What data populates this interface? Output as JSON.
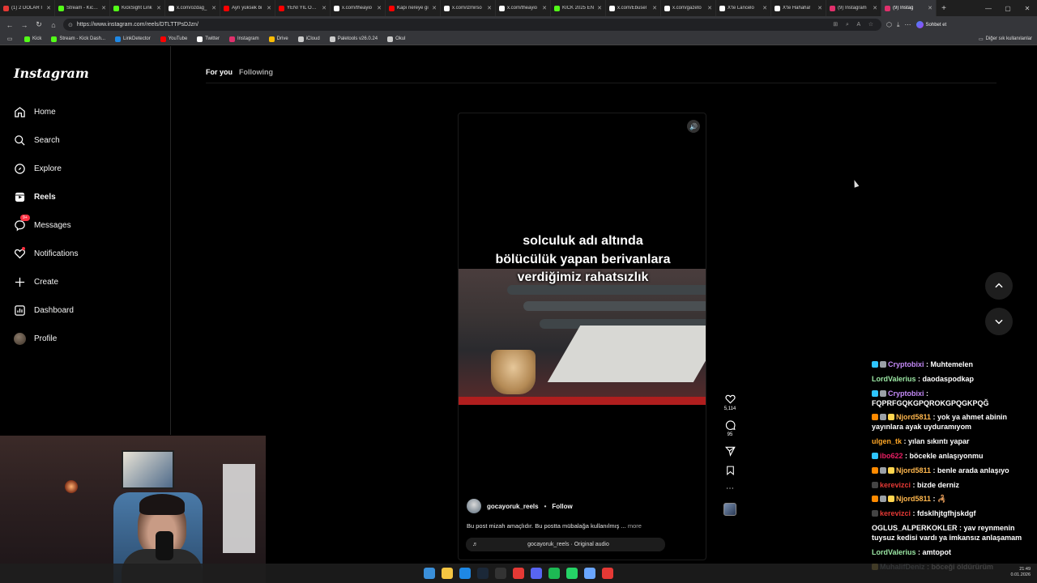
{
  "browser": {
    "tabs": [
      {
        "title": "(1) 2 DOLAR I",
        "color": "#e53935"
      },
      {
        "title": "Stream - Kick D",
        "color": "#53fc18"
      },
      {
        "title": "KickSight Link",
        "color": "#53fc18"
      },
      {
        "title": "x.com/ozdag_",
        "color": "#ffffff"
      },
      {
        "title": "Ayrı yüksek bi",
        "color": "#ff0000"
      },
      {
        "title": "YENİ YIL ÖZEL",
        "color": "#ff0000"
      },
      {
        "title": "x.com/theayio",
        "color": "#ffffff"
      },
      {
        "title": "Kapı nereye gi",
        "color": "#ff0000"
      },
      {
        "title": "x.com/izmirso",
        "color": "#ffffff"
      },
      {
        "title": "x.com/theayio",
        "color": "#ffffff"
      },
      {
        "title": "KİCK 2025 EN",
        "color": "#53fc18"
      },
      {
        "title": "x.com/Ebusel",
        "color": "#ffffff"
      },
      {
        "title": "x.com/gazeto",
        "color": "#ffffff"
      },
      {
        "title": "X'te Lancelo",
        "color": "#ffffff"
      },
      {
        "title": "X'te Hahaha!",
        "color": "#ffffff"
      },
      {
        "title": "(9) Instagram",
        "color": "#e1306c"
      },
      {
        "title": "(9) Instag",
        "color": "#e1306c",
        "active": true
      }
    ],
    "url": "https://www.instagram.com/reels/DTLTTPsDJzn/",
    "chat_button": "Sohbet et",
    "bookmarks": [
      {
        "label": "Kick",
        "color": "#53fc18"
      },
      {
        "label": "Stream - Kick Dash...",
        "color": "#53fc18"
      },
      {
        "label": "LinkDetector",
        "color": "#1e88e5"
      },
      {
        "label": "YouTube",
        "color": "#ff0000"
      },
      {
        "label": "Twitter",
        "color": "#ffffff"
      },
      {
        "label": "Instagram",
        "color": "#e1306c"
      },
      {
        "label": "Drive",
        "color": "#fbbc04"
      },
      {
        "label": "iCloud",
        "color": "#cccccc"
      },
      {
        "label": "Paletools v26.0.24",
        "color": "#cccccc"
      },
      {
        "label": "Okul",
        "color": "#cccccc"
      }
    ],
    "other_bookmarks": "Diğer sık kullanılanlar"
  },
  "sidebar": {
    "logo": "Instagram",
    "items": [
      {
        "label": "Home",
        "icon": "home-icon"
      },
      {
        "label": "Search",
        "icon": "search-icon"
      },
      {
        "label": "Explore",
        "icon": "compass-icon"
      },
      {
        "label": "Reels",
        "icon": "reels-icon",
        "active": true
      },
      {
        "label": "Messages",
        "icon": "messenger-icon",
        "badge": "9+"
      },
      {
        "label": "Notifications",
        "icon": "heart-icon"
      },
      {
        "label": "Create",
        "icon": "plus-icon"
      },
      {
        "label": "Dashboard",
        "icon": "dashboard-icon"
      },
      {
        "label": "Profile",
        "icon": "avatar"
      }
    ]
  },
  "feed_tabs": {
    "for_you": "For you",
    "following": "Following"
  },
  "reel": {
    "overlay_lines": [
      "solculuk adı altında",
      "bölücülük yapan berivanlara",
      "verdiğimiz rahatsızlık"
    ],
    "author": "gocayoruk_reels",
    "separator": "•",
    "follow": "Follow",
    "description": "Bu post mizah amaçlıdır. Bu postta mübalağa kullanılmış ...",
    "more": "more",
    "audio": "gocayoruk_reels · Original audio",
    "likes": "5,114",
    "comments": "95"
  },
  "chat": [
    {
      "user": "Cryptobixi",
      "user_color": "#c58af9",
      "text": "Muhtemelen",
      "icons": [
        "#2ec5ff",
        "#9aa0a6"
      ]
    },
    {
      "user": "LordValerius",
      "user_color": "#9be7a4",
      "text": "daodaspodkap",
      "icons": []
    },
    {
      "user": "Cryptobixi",
      "user_color": "#c58af9",
      "text": "FQPRFGQKGPQROKGPQGKPQĞ",
      "icons": [
        "#2ec5ff",
        "#9aa0a6"
      ]
    },
    {
      "user": "Njord5811",
      "user_color": "#ffb74d",
      "text": "yok ya ahmet abinin yayınlara ayak uyduramıyom",
      "icons": [
        "#ff8a00",
        "#9aa0a6",
        "#ffd54f"
      ]
    },
    {
      "user": "ulgen_tk",
      "user_color": "#ffa726",
      "text": "yılan sıkıntı yapar",
      "icons": []
    },
    {
      "user": "ibo622",
      "user_color": "#e91e63",
      "text": "böcekle anlaşıyonmu",
      "icons": [
        "#2ec5ff"
      ]
    },
    {
      "user": "Njord5811",
      "user_color": "#ffb74d",
      "text": "benle arada anlaşıyo",
      "icons": [
        "#ff8a00",
        "#9aa0a6",
        "#ffd54f"
      ]
    },
    {
      "user": "kerevizci",
      "user_color": "#e53935",
      "text": "bizde derniz",
      "icons": [
        "#444444"
      ]
    },
    {
      "user": "Njord5811",
      "user_color": "#ffb74d",
      "text": "🦂",
      "icons": [
        "#ff8a00",
        "#9aa0a6",
        "#ffd54f"
      ]
    },
    {
      "user": "kerevizci",
      "user_color": "#e53935",
      "text": "fdsklhjtgfhjskdgf",
      "icons": [
        "#444444"
      ]
    },
    {
      "user": "OGLUS_ALPERKOKLER",
      "user_color": "#ffffff",
      "text": "yav reynmenin tuysuz kedisi vardı ya imkansız anlaşamam",
      "icons": []
    },
    {
      "user": "LordValerius",
      "user_color": "#9be7a4",
      "text": "amtopot",
      "icons": []
    },
    {
      "user": "MuhalifDeniz",
      "user_color": "#b0bec5",
      "text": "böceği öldürürüm",
      "icons": [
        "#ffd54f"
      ]
    }
  ],
  "taskbar": {
    "time": "21:49",
    "date": "0.01.2026",
    "apps": [
      {
        "icon": "windows-icon",
        "color": "#3a8fd9"
      },
      {
        "icon": "folder-icon",
        "color": "#f4c542"
      },
      {
        "icon": "edge-icon",
        "color": "#1e88e5"
      },
      {
        "icon": "steam-icon",
        "color": "#1b2838"
      },
      {
        "icon": "obs-icon",
        "color": "#333333"
      },
      {
        "icon": "app-red-icon",
        "color": "#e53935"
      },
      {
        "icon": "discord-icon",
        "color": "#5865f2"
      },
      {
        "icon": "spotify-icon",
        "color": "#1db954"
      },
      {
        "icon": "whatsapp-icon",
        "color": "#25d366"
      },
      {
        "icon": "app-blue-icon",
        "color": "#6aa6ff"
      },
      {
        "icon": "chrome-icon",
        "color": "#e53935"
      }
    ]
  }
}
